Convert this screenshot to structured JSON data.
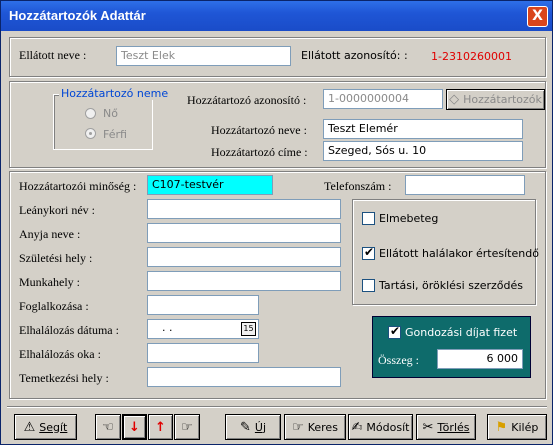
{
  "window": {
    "title": "Hozzátartozók Adattár",
    "close_label": "X"
  },
  "top": {
    "ellatott_neve_label": "Ellátott neve :",
    "ellatott_neve_value": "Teszt Elek",
    "azonosito_label": "Ellátott azonosító: :",
    "azonosito_value": "1-2310260001"
  },
  "relative_group": {
    "legend": "Hozzátartozó neme",
    "option_no": "Nő",
    "option_ferfi": "Férfi",
    "azonosito_label": "Hozzátartozó azonosító :",
    "azonosito_value": "1-0000000004",
    "lookup_button": "Hozzátartozók",
    "neve_label": "Hozzátartozó neve :",
    "neve_value": "Teszt Elemér",
    "cime_label": "Hozzátartozó címe :",
    "cime_value": "Szeged, Sós u. 10"
  },
  "details": {
    "minoseg_label": "Hozzátartozói minőség :",
    "minoseg_value": "C107-testvér",
    "telefon_label": "Telefonszám :",
    "telefon_value": "",
    "leanykori_label": "Leánykori név :",
    "anyja_label": "Anyja neve :",
    "szuletesi_label": "Születési hely :",
    "munkahely_label": "Munkahely :",
    "foglalkozasa_label": "Foglalkozása :",
    "elhalalozas_datuma_label": "Elhalálozás dátuma :",
    "elhalalozas_datuma_value": ". .",
    "calendar_label": "15",
    "elhalalozas_oka_label": "Elhalálozás oka :",
    "temetkezesi_label": "Temetkezési hely :"
  },
  "checkboxes": {
    "elmebeteg": "Elmebeteg",
    "ertesitendo": "Ellátott halálakor értesítendő",
    "szerzodes": "Tartási, öröklési szerződés"
  },
  "fee": {
    "checkbox_label": "Gondozási díjat fizet",
    "osszeg_label": "Összeg :",
    "osszeg_value": "6 000"
  },
  "toolbar": {
    "help": "Segít",
    "new": "Új",
    "search": "Keres",
    "modify": "Módosít",
    "delete": "Törlés",
    "exit": "Kilép"
  },
  "colors": {
    "title_bar": "#1f56d6",
    "id_red": "#e00000",
    "highlight": "#00ffff",
    "teal": "#0e6b6b"
  }
}
